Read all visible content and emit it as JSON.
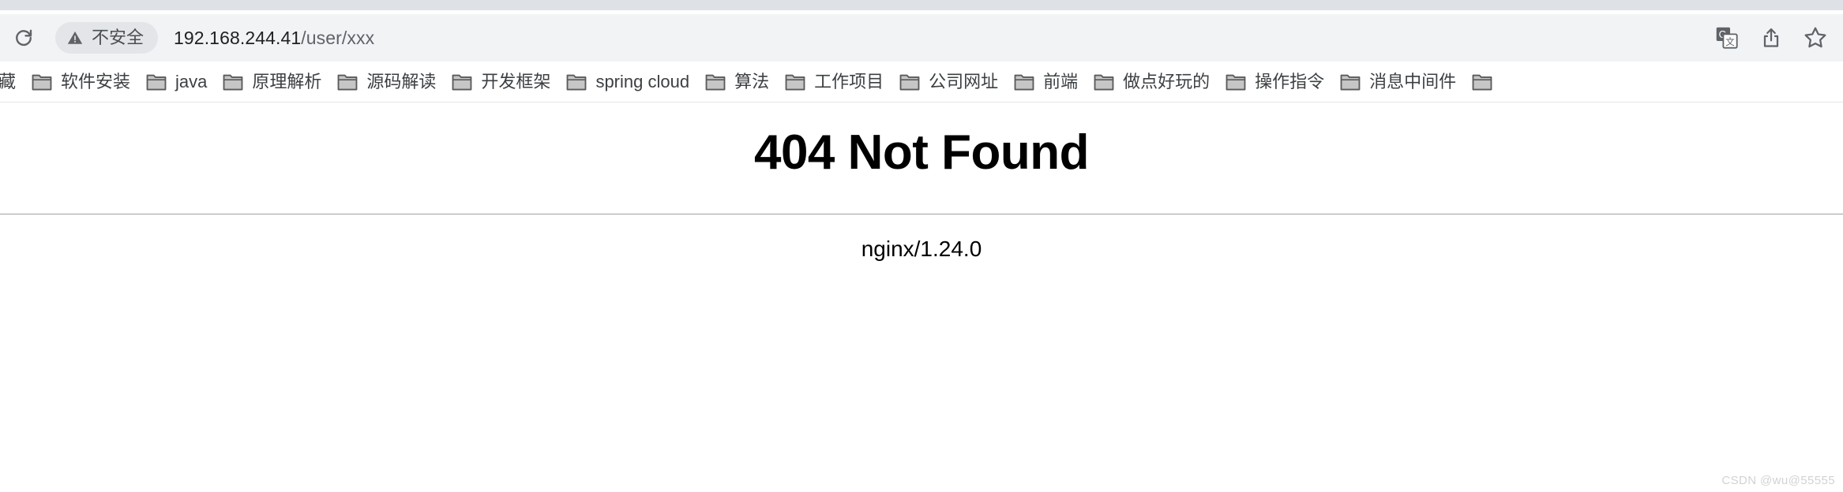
{
  "browser": {
    "reload_icon": "reload-icon",
    "omnibox": {
      "security_chip": {
        "icon": "warning-triangle-icon",
        "label": "不安全"
      },
      "url_host": "192.168.244.41",
      "url_path": "/user/xxx",
      "full_url": "192.168.244.41/user/xxx"
    },
    "actions": [
      {
        "name": "translate-icon",
        "title": "翻译此页"
      },
      {
        "name": "share-icon",
        "title": "分享"
      },
      {
        "name": "bookmark-star-icon",
        "title": "收藏"
      }
    ]
  },
  "bookmarks": {
    "folder_icon": "folder-icon",
    "items": [
      {
        "label": "藏",
        "clipped": true
      },
      {
        "label": "软件安装"
      },
      {
        "label": "java"
      },
      {
        "label": "原理解析"
      },
      {
        "label": "源码解读"
      },
      {
        "label": "开发框架"
      },
      {
        "label": "spring cloud"
      },
      {
        "label": "算法"
      },
      {
        "label": "工作项目"
      },
      {
        "label": "公司网址"
      },
      {
        "label": "前端"
      },
      {
        "label": "做点好玩的"
      },
      {
        "label": "操作指令"
      },
      {
        "label": "消息中间件"
      },
      {
        "label": "",
        "clipped": true
      }
    ]
  },
  "page": {
    "title": "404 Not Found",
    "server": "nginx/1.24.0"
  },
  "watermark": "CSDN @wu@55555",
  "colors": {
    "tabstrip": "#dee1e6",
    "toolbar": "#f1f3f4",
    "chip_bg": "#e3e5e8",
    "text_primary": "#202124",
    "text_secondary": "#5f6368",
    "page_bg": "#ffffff",
    "rule": "#a0a0a0",
    "watermark": "#d2d2d2"
  }
}
